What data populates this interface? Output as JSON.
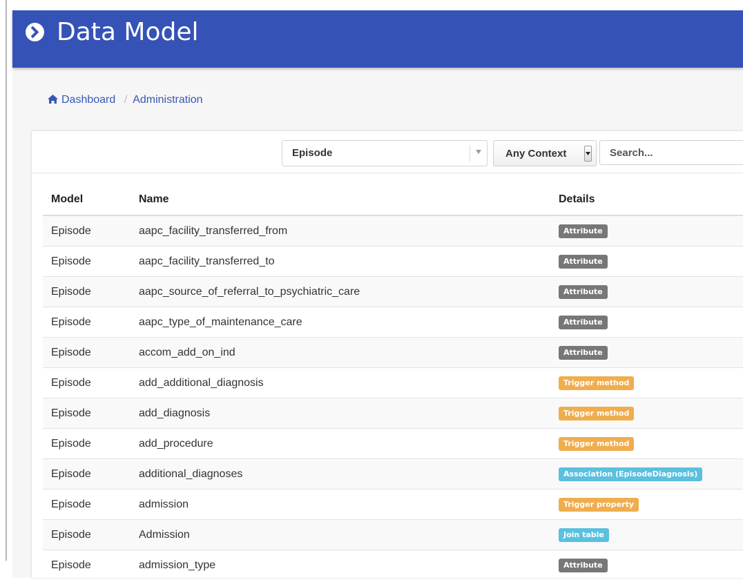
{
  "header": {
    "title": "Data Model"
  },
  "breadcrumb": {
    "home": "Dashboard",
    "current": "Administration"
  },
  "filters": {
    "model_select": "Episode",
    "context_select": "Any Context",
    "search_placeholder": "Search..."
  },
  "table": {
    "headers": [
      "Model",
      "Name",
      "Details"
    ],
    "rows": [
      {
        "model": "Episode",
        "name": "aapc_facility_transferred_from",
        "detail": "Attribute",
        "kind": "attribute"
      },
      {
        "model": "Episode",
        "name": "aapc_facility_transferred_to",
        "detail": "Attribute",
        "kind": "attribute"
      },
      {
        "model": "Episode",
        "name": "aapc_source_of_referral_to_psychiatric_care",
        "detail": "Attribute",
        "kind": "attribute"
      },
      {
        "model": "Episode",
        "name": "aapc_type_of_maintenance_care",
        "detail": "Attribute",
        "kind": "attribute"
      },
      {
        "model": "Episode",
        "name": "accom_add_on_ind",
        "detail": "Attribute",
        "kind": "attribute"
      },
      {
        "model": "Episode",
        "name": "add_additional_diagnosis",
        "detail": "Trigger method",
        "kind": "trigger"
      },
      {
        "model": "Episode",
        "name": "add_diagnosis",
        "detail": "Trigger method",
        "kind": "trigger"
      },
      {
        "model": "Episode",
        "name": "add_procedure",
        "detail": "Trigger method",
        "kind": "trigger"
      },
      {
        "model": "Episode",
        "name": "additional_diagnoses",
        "detail": "Association (EpisodeDiagnosis)",
        "kind": "association"
      },
      {
        "model": "Episode",
        "name": "admission",
        "detail": "Trigger property",
        "kind": "trigger"
      },
      {
        "model": "Episode",
        "name": "Admission",
        "detail": "Join table",
        "kind": "association"
      },
      {
        "model": "Episode",
        "name": "admission_type",
        "detail": "Attribute",
        "kind": "attribute"
      }
    ]
  },
  "colors": {
    "header": "#3552b7",
    "link": "#3a56b5",
    "attribute": "#777777",
    "trigger": "#f0ad4e",
    "association": "#5bc0de"
  }
}
